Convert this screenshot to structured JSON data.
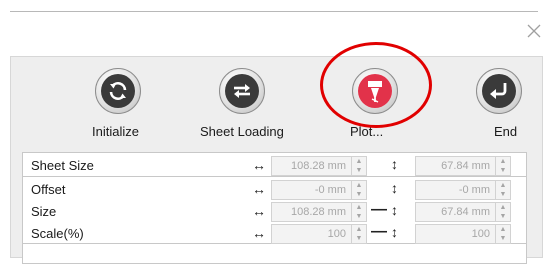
{
  "toolbar": {
    "initialize": {
      "label": "Initialize",
      "icon": "refresh-icon"
    },
    "sheet_loading": {
      "label": "Sheet Loading",
      "icon": "swap-arrows-icon"
    },
    "plot": {
      "label": "Plot...",
      "icon": "plotter-pen-icon",
      "highlighted": true,
      "highlight_color": "#e10000"
    },
    "end": {
      "label": "End",
      "icon": "return-arrow-icon"
    }
  },
  "close_icon": "close-icon",
  "rows": [
    {
      "name": "Sheet Size",
      "width": "108.28 mm",
      "height": "67.84 mm",
      "linked": false
    },
    {
      "name": "Offset",
      "width": "-0 mm",
      "height": "-0 mm",
      "linked": false
    },
    {
      "name": "Size",
      "width": "108.28 mm",
      "height": "67.84 mm",
      "linked": true
    },
    {
      "name": "Scale(%)",
      "width": "100",
      "height": "100",
      "linked": true
    }
  ],
  "glyphs": {
    "horizontal": "↔",
    "vertical": "↕",
    "spin_up": "▲",
    "spin_down": "▼"
  }
}
